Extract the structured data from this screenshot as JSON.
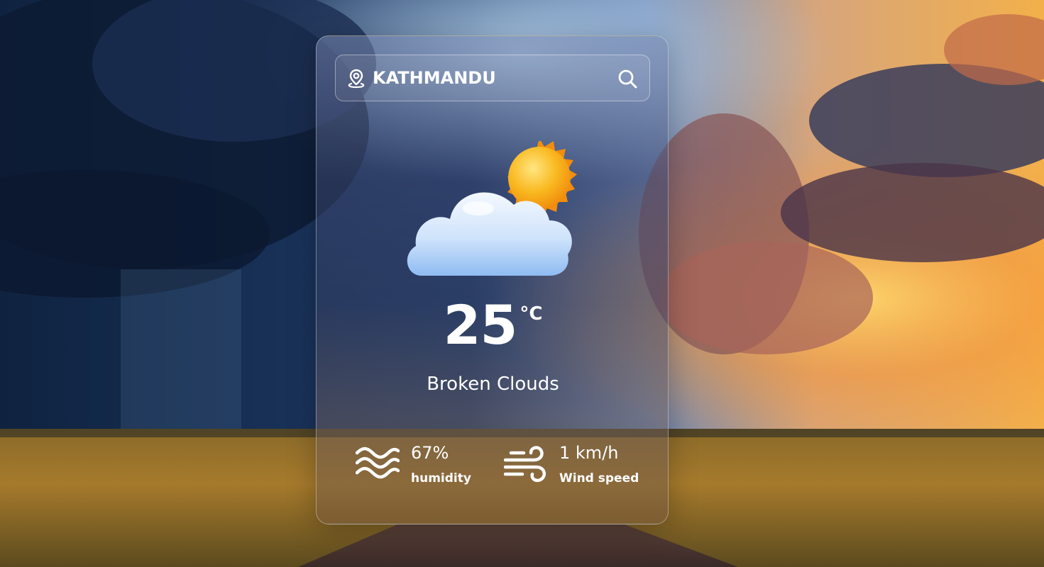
{
  "search": {
    "value": "KATHMANDU",
    "location_icon": "location-pin-icon",
    "search_icon": "search-icon"
  },
  "weather": {
    "icon": "cloud-sun-icon",
    "temperature": "25",
    "unit": "°C",
    "description": "Broken Clouds"
  },
  "details": {
    "humidity": {
      "icon": "humidity-waves-icon",
      "value": "67%",
      "label": "humidity"
    },
    "wind": {
      "icon": "wind-icon",
      "value": "1 km/h",
      "label": "Wind speed"
    }
  },
  "colors": {
    "text": "#ffffff",
    "sun": "#f7a51c",
    "cloud": "#cfe3fb"
  }
}
